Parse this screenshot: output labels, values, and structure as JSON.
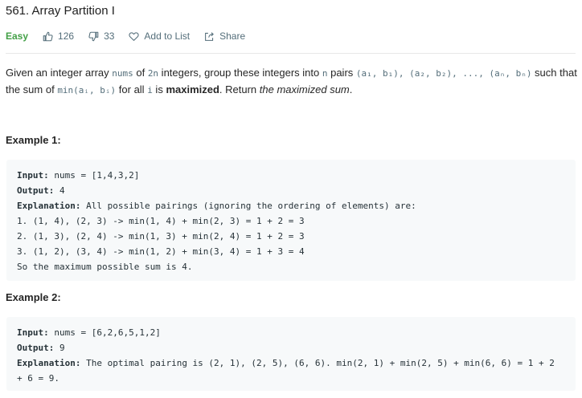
{
  "problem": {
    "title": "561. Array Partition I",
    "difficulty": "Easy",
    "likes": "126",
    "dislikes": "33",
    "add_to_list": "Add to List",
    "share": "Share"
  },
  "description": {
    "t1": "Given an integer array ",
    "c1": "nums",
    "t2": " of ",
    "c2": "2n",
    "t3": " integers, group these integers into ",
    "c3": "n",
    "t4": " pairs ",
    "c4": "(a₁, b₁), (a₂, b₂), ..., (aₙ, bₙ)",
    "t5": " such that the sum of ",
    "c5": "min(aᵢ, bᵢ)",
    "t6": " for all ",
    "c6": "i",
    "t7": " is ",
    "b1": "maximized",
    "t8": ". Return ",
    "i1": "the maximized sum",
    "t9": "."
  },
  "example1": {
    "heading": "Example 1:",
    "input_label": "Input:",
    "input_value": " nums = [1,4,3,2]",
    "output_label": "Output:",
    "output_value": " 4",
    "explanation_label": "Explanation:",
    "explanation_value": " All possible pairings (ignoring the ordering of elements) are:",
    "lines": [
      "1. (1, 4), (2, 3) -> min(1, 4) + min(2, 3) = 1 + 2 = 3",
      "2. (1, 3), (2, 4) -> min(1, 3) + min(2, 4) = 1 + 2 = 3",
      "3. (1, 2), (3, 4) -> min(1, 2) + min(3, 4) = 1 + 3 = 4",
      "So the maximum possible sum is 4."
    ]
  },
  "example2": {
    "heading": "Example 2:",
    "input_label": "Input:",
    "input_value": " nums = [6,2,6,5,1,2]",
    "output_label": "Output:",
    "output_value": " 9",
    "explanation_label": "Explanation:",
    "explanation_value": " The optimal pairing is (2, 1), (2, 5), (6, 6). min(2, 1) + min(2, 5) + min(6, 6) = 1 + 2",
    "continuation": "+ 6 = 9."
  },
  "colors": {
    "easy": "#43a047",
    "meta": "#546e7a",
    "code_bg": "#f7f9fa"
  },
  "icons": {
    "likes": "thumbs-up-icon",
    "dislikes": "thumbs-down-icon",
    "add_to_list": "heart-icon",
    "share": "share-icon"
  }
}
